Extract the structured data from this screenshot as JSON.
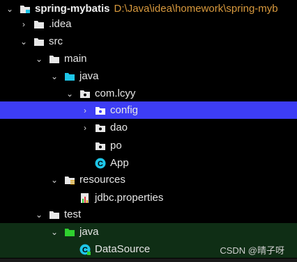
{
  "tree": {
    "project": {
      "label": "spring-mybatis",
      "path": "D:\\Java\\idea\\homework\\spring-myb"
    },
    "items": [
      {
        "label": ".idea",
        "icon": "folder-icon"
      },
      {
        "label": "src",
        "icon": "folder-icon"
      },
      {
        "label": "main",
        "icon": "folder-icon"
      },
      {
        "label": "java",
        "icon": "source-folder-icon"
      },
      {
        "label": "com.lcyy",
        "icon": "package-icon"
      },
      {
        "label": "config",
        "icon": "package-icon"
      },
      {
        "label": "dao",
        "icon": "package-icon"
      },
      {
        "label": "po",
        "icon": "package-icon"
      },
      {
        "label": "App",
        "icon": "java-class-icon"
      },
      {
        "label": "resources",
        "icon": "resources-folder-icon"
      },
      {
        "label": "jdbc.properties",
        "icon": "properties-file-icon"
      },
      {
        "label": "test",
        "icon": "folder-icon"
      },
      {
        "label": "java",
        "icon": "test-source-folder-icon"
      },
      {
        "label": "DataSource",
        "icon": "java-test-class-icon"
      }
    ]
  },
  "watermark": "CSDN @晴子呀",
  "colors": {
    "background": "#000000",
    "selection": "#3d3df5",
    "test_background": "#0f2e15",
    "source_folder": "#1ec6e8",
    "test_folder": "#2fd12f",
    "path_text": "#d99a3e"
  }
}
